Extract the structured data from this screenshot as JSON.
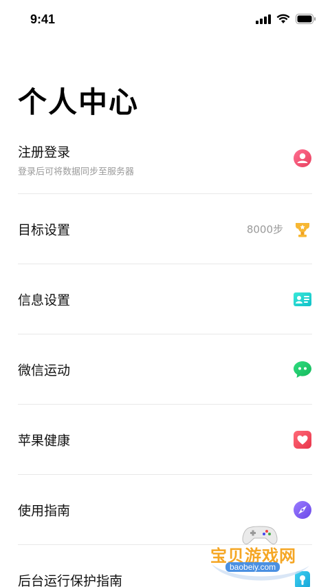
{
  "status_bar": {
    "time": "9:41"
  },
  "page": {
    "title": "个人中心"
  },
  "menu": {
    "items": [
      {
        "label": "注册登录",
        "sub": "登录后可将数据同步至服务器",
        "value": "",
        "icon": "user-icon",
        "color": "#f0506e"
      },
      {
        "label": "目标设置",
        "sub": "",
        "value": "8000步",
        "icon": "trophy-icon",
        "color": "#f7b733"
      },
      {
        "label": "信息设置",
        "sub": "",
        "value": "",
        "icon": "id-card-icon",
        "color": "#1ed8c8"
      },
      {
        "label": "微信运动",
        "sub": "",
        "value": "",
        "icon": "wechat-icon",
        "color": "#20c86a"
      },
      {
        "label": "苹果健康",
        "sub": "",
        "value": "",
        "icon": "heart-icon",
        "color": "#f2485a"
      },
      {
        "label": "使用指南",
        "sub": "",
        "value": "",
        "icon": "compass-icon",
        "color": "#7b5ff0"
      },
      {
        "label": "后台运行保护指南",
        "sub": "",
        "value": "",
        "icon": "shield-icon",
        "color": "#22b8e6"
      }
    ]
  },
  "watermark": {
    "text": "宝贝游戏网",
    "url": "baobeiy.com"
  }
}
